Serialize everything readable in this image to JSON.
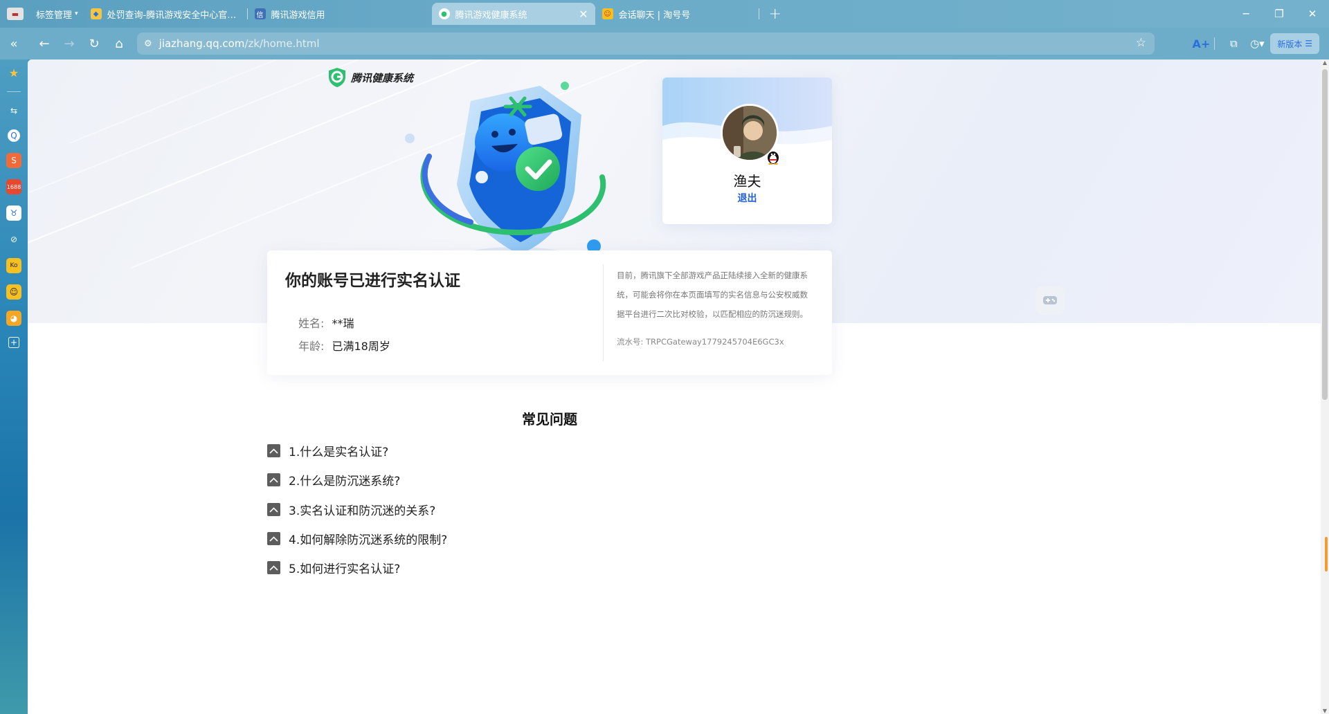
{
  "browser": {
    "bookmark_manager": "标签管理",
    "tabs": [
      {
        "title": "处罚查询-腾讯游戏安全中心官网-腾讯游戏",
        "active": false
      },
      {
        "title": "腾讯游戏信用",
        "active": false
      },
      {
        "title": "腾讯游戏健康系统",
        "active": true
      },
      {
        "title": "会话聊天 | 淘号号",
        "active": false
      }
    ],
    "url_host": "jiazhang.qq.com",
    "url_path": "/zk/home.html",
    "new_version_label": "新版本",
    "ai_label": "A+"
  },
  "page": {
    "logo_text": "腾讯健康系统",
    "user": {
      "name": "渔夫",
      "logout": "退出"
    },
    "verification": {
      "title": "你的账号已进行实名认证",
      "name_label": "姓名:",
      "name_value": "**瑞",
      "age_label": "年龄:",
      "age_value": "已满18周岁",
      "notice": "目前，腾讯旗下全部游戏产品正陆续接入全新的健康系统，可能会将你在本页面填写的实名信息与公安权威数据平台进行二次比对校验，以匹配相应的防沉迷规则。",
      "serial": "流水号: TRPCGateway1779245704E6GC3x"
    },
    "faq": {
      "title": "常见问题",
      "items": [
        "1.什么是实名认证?",
        "2.什么是防沉迷系统?",
        "3.实名认证和防沉迷的关系?",
        "4.如何解除防沉迷系统的限制?",
        "5.如何进行实名认证?"
      ]
    }
  },
  "colors": {
    "accent_blue": "#1f5fd6",
    "brand_green": "#2fbf71",
    "chrome_blue": "#6eadc9"
  }
}
